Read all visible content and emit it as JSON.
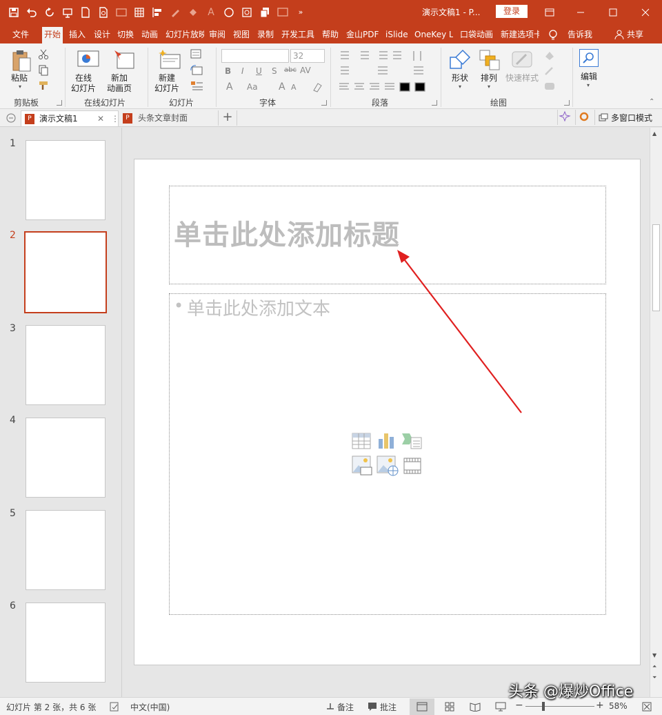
{
  "window": {
    "title": "演示文稿1 - P...",
    "login_label": "登录",
    "minimize_icon": "minimize-icon",
    "restore_icon": "restore-icon",
    "close_icon": "close-icon"
  },
  "qat": [
    "save-icon",
    "undo-icon",
    "redo-icon",
    "present-icon",
    "new-icon",
    "print-preview-icon",
    "image-icon",
    "grid-icon",
    "align-icon",
    "pen-icon",
    "fill-icon",
    "font-color-icon",
    "circle-icon",
    "select-icon",
    "copy-icon",
    "screen-icon",
    "more-icon"
  ],
  "tabs": [
    "文件",
    "开始",
    "插入",
    "设计",
    "切换",
    "动画",
    "幻灯片放映",
    "审阅",
    "视图",
    "录制",
    "开发工具",
    "帮助",
    "金山PDF",
    "iSlide",
    "OneKey L",
    "口袋动画",
    "新建选项卡",
    "告诉我",
    "共享"
  ],
  "active_tab": "开始",
  "ribbon": {
    "clipboard": {
      "paste": "粘贴",
      "group": "剪贴板"
    },
    "online": {
      "online_slides": "在线\n幻灯片",
      "new_page": "新加\n动画页",
      "group": "在线幻灯片"
    },
    "slides": {
      "new_slide": "新建\n幻灯片",
      "group": "幻灯片"
    },
    "font": {
      "size": "32",
      "group": "字体",
      "bold": "B",
      "italic": "I",
      "underline": "U",
      "shadow": "S",
      "strike": "abc",
      "spacing": "AV",
      "font_color": "A",
      "case": "Aa",
      "grow": "A",
      "shrink": "A"
    },
    "paragraph": {
      "group": "段落"
    },
    "drawing": {
      "shapes": "形状",
      "arrange": "排列",
      "quick_styles": "快速样式",
      "group": "绘图"
    },
    "editing": {
      "edit": "编辑"
    }
  },
  "doctabs": {
    "tab1": "演示文稿1",
    "tab2": "头条文章封面",
    "add": "+",
    "multiwin": "多窗口模式"
  },
  "slides": [
    {
      "num": "1"
    },
    {
      "num": "2",
      "selected": true
    },
    {
      "num": "3"
    },
    {
      "num": "4"
    },
    {
      "num": "5"
    },
    {
      "num": "6"
    }
  ],
  "slide": {
    "title_placeholder": "单击此处添加标题",
    "content_placeholder": "单击此处添加文本",
    "bullet": "•",
    "content_icons": [
      "table-icon",
      "chart-icon",
      "smartart-icon",
      "picture-icon",
      "online-picture-icon",
      "video-icon"
    ]
  },
  "accent": "#c43e1c",
  "annotation_arrow_color": "#e02020",
  "status": {
    "slide_info": "幻灯片 第 2 张，共 6 张",
    "language": "中文(中国)",
    "notes": "备注",
    "comments": "批注",
    "zoom": "58%",
    "watermark": "头条 @爆炒Office"
  }
}
